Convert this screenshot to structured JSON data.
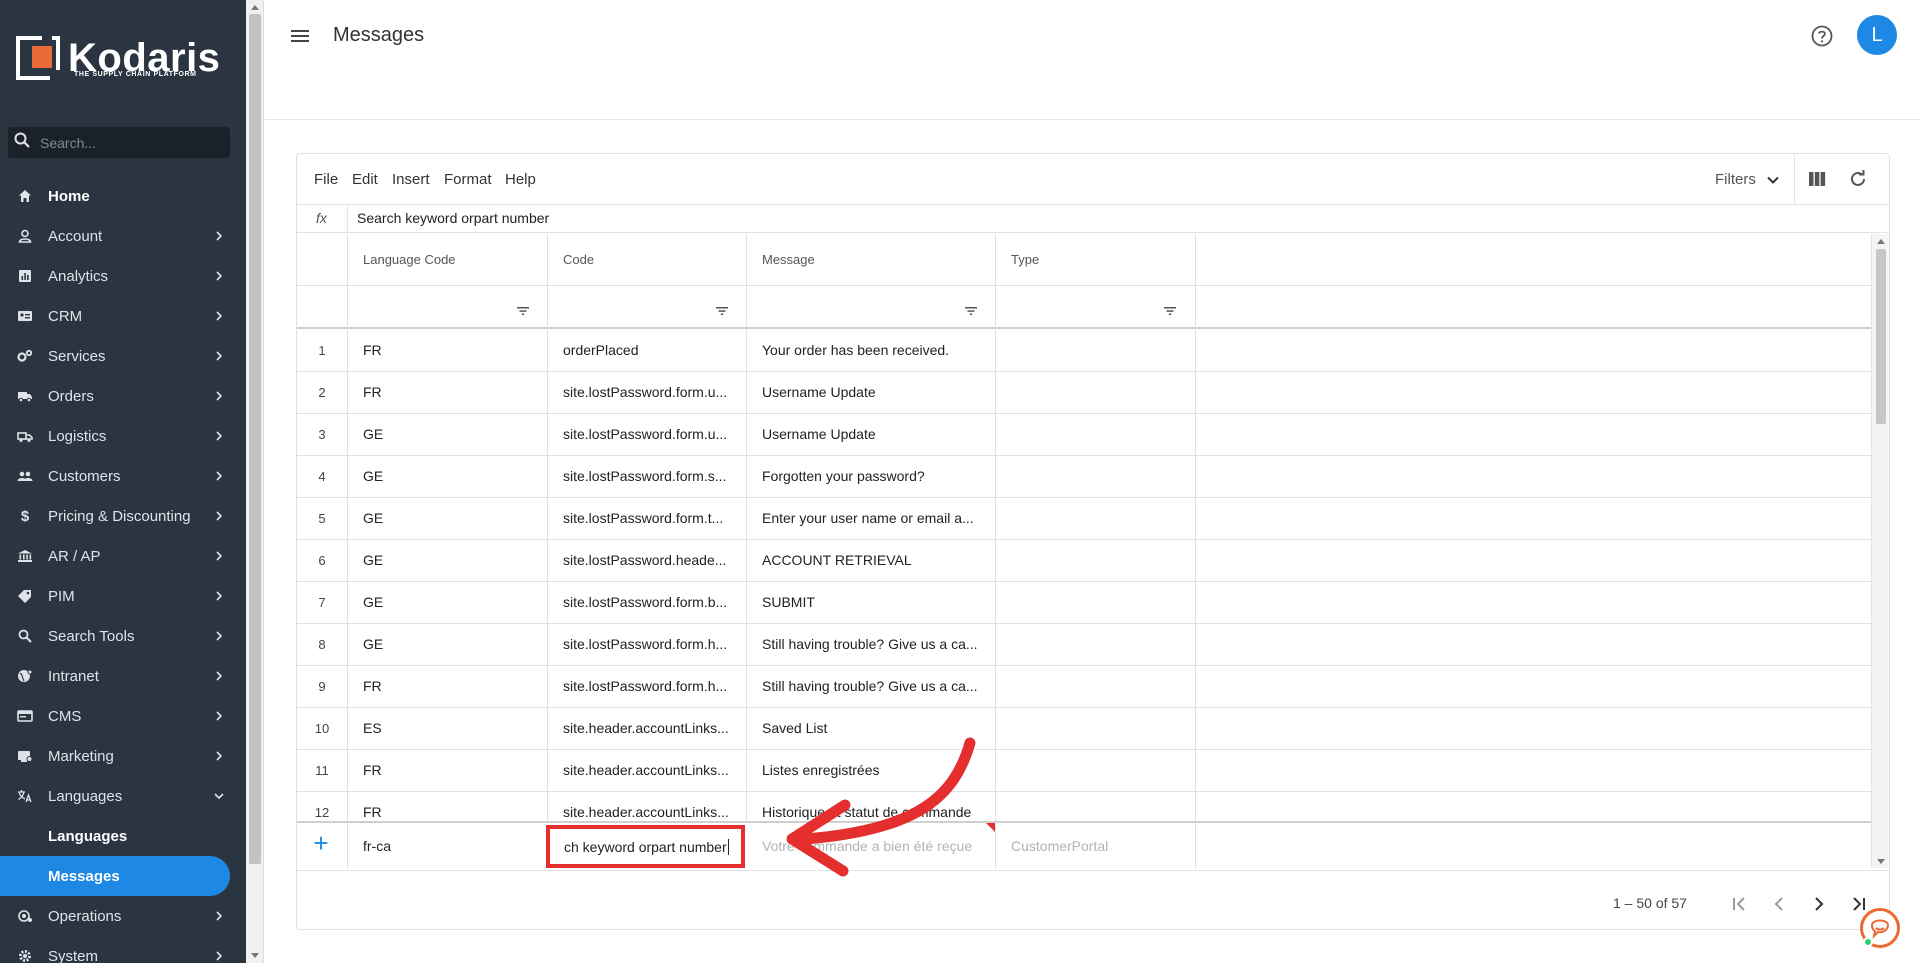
{
  "sidebar": {
    "logo_text": "Kodaris",
    "logo_subtitle": "THE SUPPLY CHAIN PLATFORM",
    "search_placeholder": "Search...",
    "items": [
      {
        "label": "Home",
        "icon": "home-icon",
        "expandable": false
      },
      {
        "label": "Account",
        "icon": "person-icon",
        "expandable": true
      },
      {
        "label": "Analytics",
        "icon": "analytics-icon",
        "expandable": true
      },
      {
        "label": "CRM",
        "icon": "contact-card-icon",
        "expandable": true
      },
      {
        "label": "Services",
        "icon": "gears-icon",
        "expandable": true
      },
      {
        "label": "Orders",
        "icon": "truck-icon",
        "expandable": true
      },
      {
        "label": "Logistics",
        "icon": "shipping-icon",
        "expandable": true
      },
      {
        "label": "Customers",
        "icon": "group-icon",
        "expandable": true
      },
      {
        "label": "Pricing & Discounting",
        "icon": "dollar-icon",
        "expandable": true
      },
      {
        "label": "AR / AP",
        "icon": "bank-icon",
        "expandable": true
      },
      {
        "label": "PIM",
        "icon": "tag-icon",
        "expandable": true
      },
      {
        "label": "Search Tools",
        "icon": "search-icon",
        "expandable": true
      },
      {
        "label": "Intranet",
        "icon": "globe-icon",
        "expandable": true
      },
      {
        "label": "CMS",
        "icon": "web-icon",
        "expandable": true
      },
      {
        "label": "Marketing",
        "icon": "marketing-icon",
        "expandable": true
      },
      {
        "label": "Languages",
        "icon": "translate-icon",
        "expandable": true,
        "expanded": true
      }
    ],
    "subitems": [
      {
        "label": "Languages",
        "active": false
      },
      {
        "label": "Messages",
        "active": true
      }
    ],
    "items_after": [
      {
        "label": "Operations",
        "icon": "operations-icon",
        "expandable": true
      },
      {
        "label": "System",
        "icon": "settings-icon",
        "expandable": true
      }
    ]
  },
  "header": {
    "title": "Messages",
    "avatar_letter": "L"
  },
  "menubar": {
    "items": [
      "File",
      "Edit",
      "Insert",
      "Format",
      "Help"
    ],
    "filters_label": "Filters"
  },
  "formula_bar": {
    "label": "fx",
    "value": "Search keyword orpart number"
  },
  "grid": {
    "columns": [
      "Language Code",
      "Code",
      "Message",
      "Type"
    ],
    "rows": [
      {
        "num": "1",
        "lang": "FR",
        "code": "orderPlaced",
        "message": "Your order has been received.",
        "type": ""
      },
      {
        "num": "2",
        "lang": "FR",
        "code": "site.lostPassword.form.u...",
        "message": "Username Update",
        "type": ""
      },
      {
        "num": "3",
        "lang": "GE",
        "code": "site.lostPassword.form.u...",
        "message": "Username Update",
        "type": ""
      },
      {
        "num": "4",
        "lang": "GE",
        "code": "site.lostPassword.form.s...",
        "message": "Forgotten your password?",
        "type": ""
      },
      {
        "num": "5",
        "lang": "GE",
        "code": "site.lostPassword.form.t...",
        "message": "Enter your user name or email a...",
        "type": ""
      },
      {
        "num": "6",
        "lang": "GE",
        "code": "site.lostPassword.heade...",
        "message": "ACCOUNT RETRIEVAL",
        "type": ""
      },
      {
        "num": "7",
        "lang": "GE",
        "code": "site.lostPassword.form.b...",
        "message": "SUBMIT",
        "type": ""
      },
      {
        "num": "8",
        "lang": "GE",
        "code": "site.lostPassword.form.h...",
        "message": "Still having trouble? Give us a ca...",
        "type": ""
      },
      {
        "num": "9",
        "lang": "FR",
        "code": "site.lostPassword.form.h...",
        "message": "Still having trouble? Give us a ca...",
        "type": ""
      },
      {
        "num": "10",
        "lang": "ES",
        "code": "site.header.accountLinks...",
        "message": "Saved List",
        "type": ""
      },
      {
        "num": "11",
        "lang": "FR",
        "code": "site.header.accountLinks...",
        "message": "Listes enregistrées",
        "type": ""
      },
      {
        "num": "12",
        "lang": "FR",
        "code": "site.header.accountLinks...",
        "message": "Historique et statut de commande",
        "type": ""
      }
    ],
    "new_row": {
      "lang": "fr-ca",
      "code_value": "ch keyword orpart number",
      "message_placeholder": "Votre commande a bien été reçue",
      "type": "CustomerPortal"
    }
  },
  "pager": {
    "range": "1 – 50 of 57"
  },
  "colors": {
    "sidebar_bg": "#2b3542",
    "accent": "#1e88e5",
    "highlight": "#e52e2e",
    "chat": "#e96a36"
  }
}
